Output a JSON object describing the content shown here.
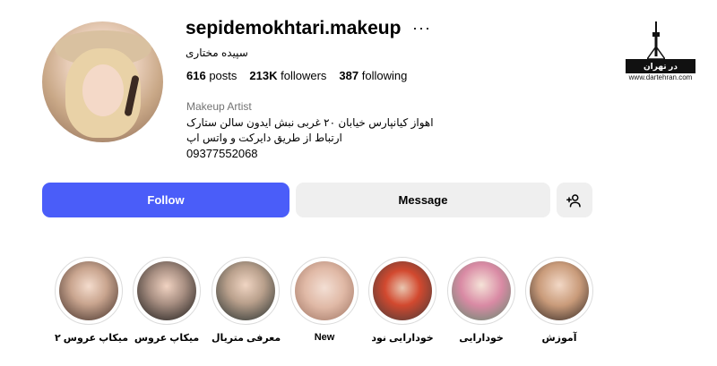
{
  "profile": {
    "username": "sepidemokhtari.makeup",
    "full_name": "سپیده مختاری",
    "posts_count": "616",
    "posts_label": "posts",
    "followers_count": "213K",
    "followers_label": "followers",
    "following_count": "387",
    "following_label": "following",
    "category": "Makeup Artist",
    "bio_line1": "اهواز کیانپارس خیابان ۲۰ غربی نبش ایدون سالن ستارک",
    "bio_line2": "ارتباط از طریق دایرکت و واتس اپ",
    "phone": "09377552068"
  },
  "actions": {
    "follow_label": "Follow",
    "message_label": "Message",
    "add_user_icon": "add-user-icon",
    "more_icon": "more-options-icon"
  },
  "highlights": [
    {
      "label": "آموزش"
    },
    {
      "label": "خودارایی"
    },
    {
      "label": "خودارایی نود"
    },
    {
      "label": "New"
    },
    {
      "label": "معرفی متریال"
    },
    {
      "label": "میکاپ عروس"
    },
    {
      "label": "میکاپ عروس ۲"
    }
  ],
  "watermark": {
    "name": "در تهران",
    "url": "www.dartehran.com"
  },
  "colors": {
    "follow_button": "#4a5df9",
    "secondary_button": "#efefef",
    "muted_text": "#737373"
  }
}
